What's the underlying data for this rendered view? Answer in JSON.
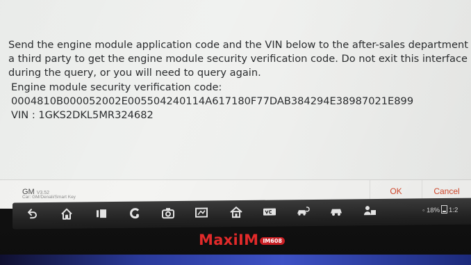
{
  "dialog": {
    "message_lines": [
      "Send the engine module application code and the VIN below to the after-sales department or",
      "a third party to get the engine module security verification code. Do not exit this interface",
      "during the query, or you will need to query again.",
      "Engine module security verification code:",
      "0004810B000052002E005504240114A617180F77DAB384294E38987021E899",
      "VIN : 1GKS2DKL5MR324682"
    ]
  },
  "footer": {
    "brand": "GM",
    "version": "V3.52",
    "path": "Car: GM/Denali/Smart Key",
    "ok_label": "OK",
    "cancel_label": "Cancel"
  },
  "navbar": {
    "icons": [
      "back-icon",
      "home-icon",
      "recent-apps-icon",
      "browser-icon",
      "camera-icon",
      "screenshot-icon",
      "maxi-home-icon",
      "vci-icon",
      "car-reset-icon",
      "car-icon",
      "remote-support-icon"
    ],
    "status_battery": "18%",
    "status_time": "1:2"
  },
  "bezel": {
    "logo_text": "MaxiIM",
    "model_badge": "IM608"
  },
  "colors": {
    "accent": "#d4482c",
    "logo_red": "#e12a2a",
    "screen_bg": "#eef0ee",
    "navbar_bg": "#262626"
  }
}
